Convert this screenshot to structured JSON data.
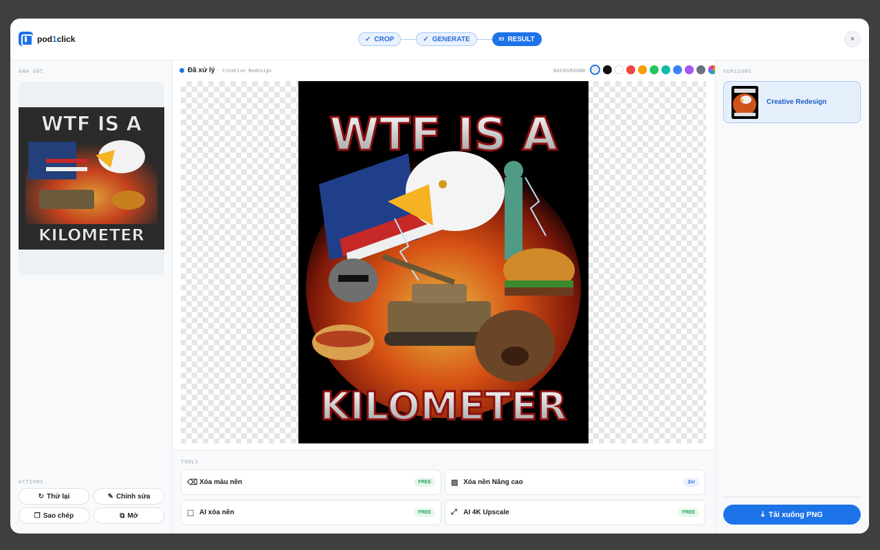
{
  "header": {
    "logo_prefix": "pod",
    "logo_accent": "1",
    "logo_suffix": "click",
    "steps": [
      {
        "label": "CROP",
        "marker": "✓"
      },
      {
        "label": "GENERATE",
        "marker": "✓"
      },
      {
        "label": "RESULT",
        "marker": "03"
      }
    ],
    "close_glyph": "×"
  },
  "left": {
    "original_label": "ẢNH GỐC",
    "actions_label": "ACTIONS",
    "actions": [
      {
        "label": "Thử lại",
        "icon": "↻"
      },
      {
        "label": "Chỉnh sửa",
        "icon": "✎"
      },
      {
        "label": "Sao chép",
        "icon": "❐"
      },
      {
        "label": "Mở",
        "icon": "⧉"
      }
    ],
    "original_art": {
      "line1": "WTF IS A",
      "line2": "KILOMETER"
    }
  },
  "center": {
    "status": "Đã xử lý",
    "status_sub": "· Creative Redesign",
    "background_label": "BACKGROUND",
    "swatches": [
      "transparent",
      "#111111",
      "#ffffff",
      "#ef4444",
      "#f59e0b",
      "#22c55e",
      "#14b8a6",
      "#3b82f6",
      "#a855f7",
      "#6b7280",
      "rainbow"
    ],
    "result_art": {
      "line1": "WTF IS A",
      "line2": "KILOMETER"
    },
    "tools_label": "TOOLS",
    "tools": [
      {
        "label": "Xóa màu nền",
        "badge": "FREE",
        "icon": "⌫"
      },
      {
        "label": "Xóa nền Nâng cao",
        "badge": "2cr",
        "icon": "▨"
      },
      {
        "label": "AI xóa nền",
        "badge": "FREE",
        "icon": "⬚"
      },
      {
        "label": "AI 4K Upscale",
        "badge": "FREE",
        "icon": "⤢"
      }
    ]
  },
  "right": {
    "versions_label": "VERSIONS",
    "version_name": "Creative Redesign",
    "download_label": "Tải xuống PNG",
    "download_icon": "⤓"
  },
  "colors": {
    "accent": "#1d73e8",
    "free_badge": "#24a35a"
  }
}
